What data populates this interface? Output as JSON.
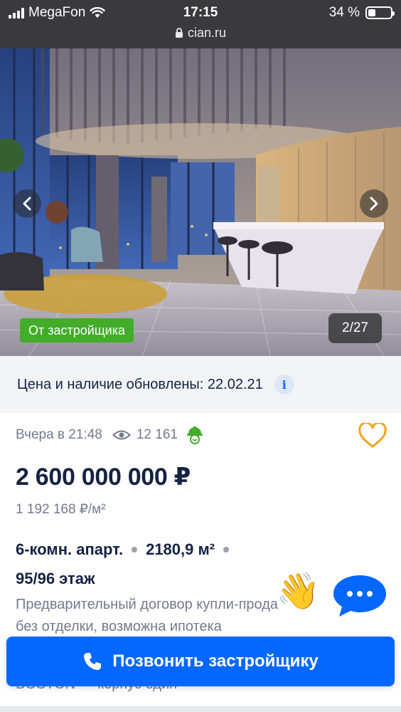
{
  "status_bar": {
    "carrier": "MegaFon",
    "time": "17:15",
    "battery": "34 %",
    "battery_level": 0.34,
    "url": "cian.ru"
  },
  "gallery": {
    "badge": "От застройщика",
    "counter": "2/27",
    "prev_icon": "chevron-left-icon",
    "next_icon": "chevron-right-icon"
  },
  "update_banner": {
    "text": "Цена и наличие обновлены: 22.02.21",
    "info": "i"
  },
  "listing": {
    "published": "Вчера в 21:48",
    "views": "12 161",
    "price": "2 600 000 000 ₽",
    "price_per_m2": "1 192 168 ₽/м²",
    "rooms": "6-комн. апарт.",
    "area": "2180,9 м²",
    "floor": "95/96 этаж",
    "desc_line1": "Предварительный договор купли-прода",
    "desc_line2": "без отделки, возможна ипотека",
    "desc_line3": "BOSTON — корпус один"
  },
  "call_button": {
    "label": "Позвонить застройщику"
  },
  "colors": {
    "accent": "#0468ff",
    "badge_green": "#41ad29",
    "text_primary": "#152242",
    "text_secondary": "#737a8e",
    "heart": "#f4a11d"
  }
}
